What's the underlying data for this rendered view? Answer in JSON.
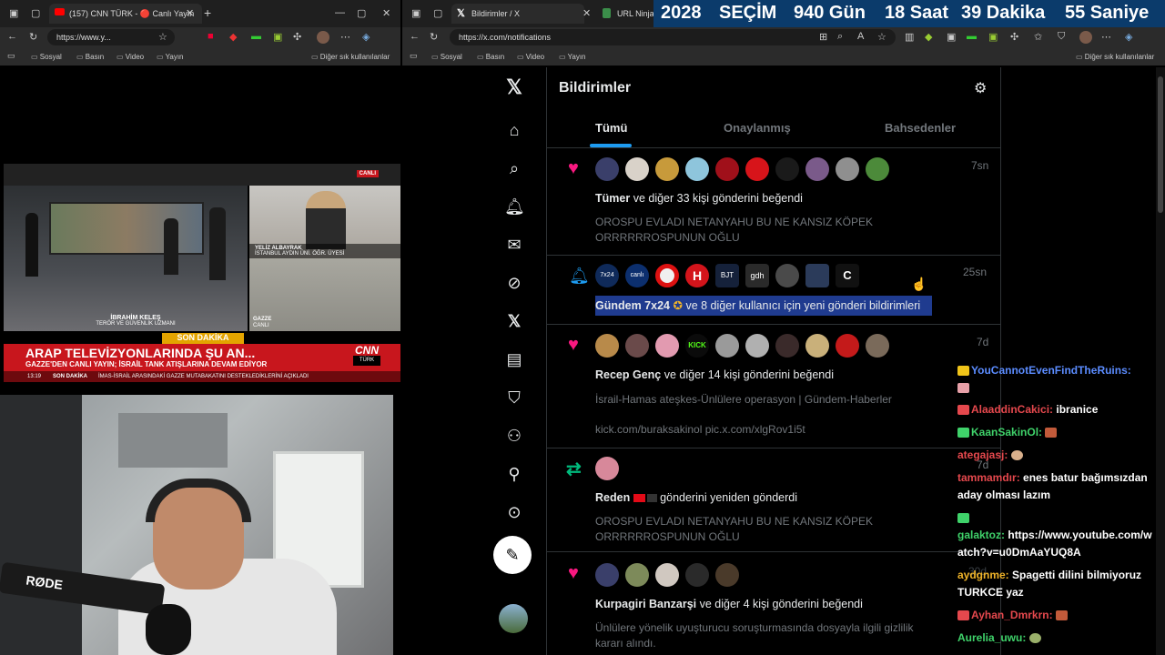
{
  "left_browser": {
    "tab_title": "(157) CNN TÜRK - 🔴 Canlı Yayın",
    "address": "https://www.y...",
    "bookmarks": [
      "Sosyal",
      "Basın",
      "Video",
      "Yayın"
    ],
    "other_bookmarks": "Diğer sık kullanılanlar"
  },
  "tv": {
    "live_badge": "CANLI",
    "guest_name": "YELİZ ALBAYRAK",
    "guest_title": "İSTANBUL AYDIN ÜNİ. ÖĞR. ÜYESİ",
    "host_name": "İBRAHİM KELEŞ",
    "host_title": "TERÖR VE GÜVENLİK UZMANI",
    "gaza_label": "GAZZE",
    "gaza_sub": "CANLI",
    "son_dakika": "SON DAKİKA",
    "headline": "ARAP TELEVİZYONLARINDA ŞU AN...",
    "subheadline": "GAZZE'DEN CANLI YAYIN; İSRAİL TANK ATIŞLARINA DEVAM EDİYOR",
    "ticker_time": "13:19",
    "ticker_label": "SON DAKİKA",
    "ticker_text": "İMAS-İSRAİL ARASINDAKİ GAZZE MUTABAKATINI DESTEKLEDİKLERİNİ AÇIKLADI",
    "brand": "CNN",
    "brand_sub": "TÜRK"
  },
  "right_browser": {
    "tab_title": "Bildirimler / X",
    "tab2_title": "URL Ninja (",
    "address": "https://x.com/notifications",
    "bookmarks": [
      "Sosyal",
      "Basın",
      "Video",
      "Yayın"
    ],
    "other_bookmarks": "Diğer sık kullanılanlar"
  },
  "countdown": {
    "year": "2028",
    "label": "SEÇİM",
    "days": "940 Gün",
    "hours": "18 Saat",
    "minutes": "39 Dakika",
    "seconds": "55 Saniye"
  },
  "x": {
    "page_title": "Bildirimler",
    "tabs": [
      "Tümü",
      "Onaylanmış",
      "Bahsedenler"
    ],
    "notifications": [
      {
        "actor": "Tümer",
        "action": "ve diğer 33 kişi gönderini beğendi",
        "quote1": "OROSPU EVLADI NETANYAHU BU NE KANSIZ KÖPEK",
        "quote2": "ORRRRRROSPUNUN OĞLU",
        "time": "7sn"
      },
      {
        "actor": "Gündem 7x24",
        "action": "ve 8 diğer kullanıcı için yeni gönderi bildirimleri",
        "time": "25sn",
        "avatars": [
          "7x24",
          "canlı",
          "",
          "H",
          "BJT",
          "gdh",
          "",
          "",
          "C"
        ]
      },
      {
        "actor": "Recep Genç",
        "action": "ve diğer 14 kişi gönderini beğendi",
        "quote1": "İsrail-Hamas ateşkes-Ünlülere operasyon | Gündem-Haberler",
        "quote2": "kick.com/buraksakinol pic.x.com/xlgRov1i5t",
        "time": "7d",
        "avatar_kick": "KICK"
      },
      {
        "actor": "Reden",
        "action": "gönderini yeniden gönderdi",
        "quote1": "OROSPU EVLADI NETANYAHU BU NE KANSIZ KÖPEK",
        "quote2": "ORRRRRROSPUNUN OĞLU",
        "time": "7d"
      },
      {
        "actor": "Kurpagiri Banzarşi",
        "action": "ve diğer 4 kişi gönderini beğendi",
        "quote1": "Ünlülere yönelik uyuşturucu soruşturmasında dosyayla ilgili gizlilik",
        "quote2": "kararı alındı.",
        "time": "30d"
      }
    ]
  },
  "chat": [
    {
      "user": "YouCannotEvenFindTheRuins:",
      "msg": "",
      "color": "#5b8cff"
    },
    {
      "user": "AlaaddinCakici:",
      "msg": "ibranice",
      "color": "#e5484d"
    },
    {
      "user": "KaanSakinOl:",
      "msg": "",
      "color": "#3fd26a"
    },
    {
      "user": "ategajasj:",
      "msg": "",
      "color": "#e5484d"
    },
    {
      "user": "tammamdır:",
      "msg": "enes batur bağımsızdan aday olması lazım",
      "color": "#e5484d"
    },
    {
      "user": "galaktoz:",
      "msg": "https://www.youtube.com/watch?v=u0DmAaYUQ8A",
      "color": "#3fd26a"
    },
    {
      "user": "aydgnme:",
      "msg": "Spagetti dilini bilmiyoruz TURKCE yaz",
      "color": "#f0b429"
    },
    {
      "user": "Ayhan_Dmrkrn:",
      "msg": "",
      "color": "#e5484d"
    },
    {
      "user": "Aurelia_uwu:",
      "msg": "",
      "color": "#3fd26a"
    }
  ],
  "colors": {
    "accent": "#1d9bf0",
    "like": "#f91880",
    "retweet": "#00ba7c",
    "x_bg": "#000000",
    "countdown_bg": "#0b3b6b"
  }
}
